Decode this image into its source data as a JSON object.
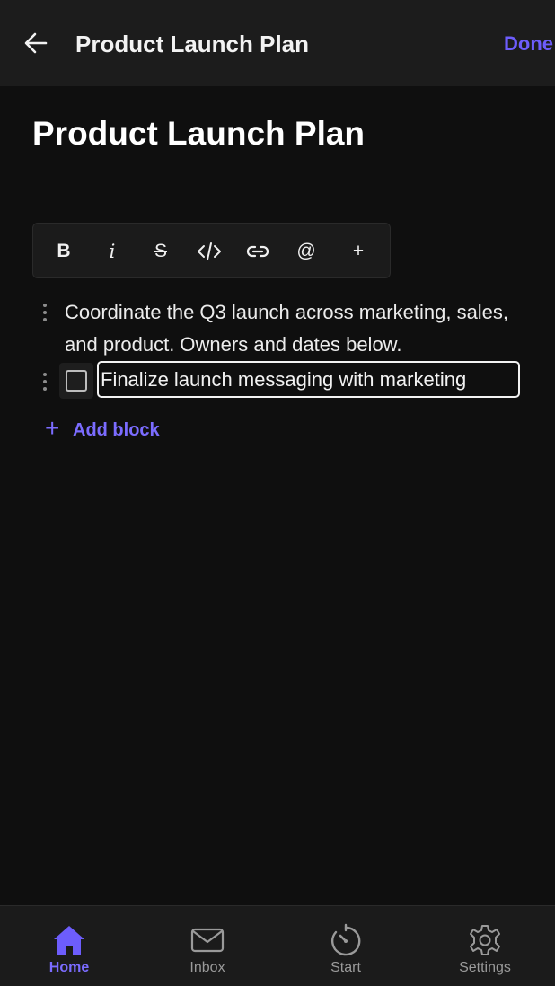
{
  "header": {
    "back_icon": "arrow-left-icon",
    "title": "Product Launch Plan",
    "done_label": "Done"
  },
  "document": {
    "title": "Product Launch Plan",
    "blocks": [
      {
        "type": "paragraph",
        "text": "Coordinate the Q3 launch across marketing, sales, and product. Owners and dates below."
      },
      {
        "type": "todo",
        "checked": false,
        "value": "Finalize launch messaging with marketing"
      }
    ],
    "add_block_label": "Add block"
  },
  "toolbar": {
    "bold": "B",
    "italic": "i",
    "strikethrough": "S",
    "mention": "@",
    "insert": "+"
  },
  "bottom_nav": {
    "items": [
      {
        "label": "Home",
        "icon": "home-icon",
        "active": true
      },
      {
        "label": "Inbox",
        "icon": "mail-icon",
        "active": false
      },
      {
        "label": "Start",
        "icon": "timer-icon",
        "active": false
      },
      {
        "label": "Settings",
        "icon": "gear-icon",
        "active": false
      }
    ]
  },
  "colors": {
    "accent": "#6d5dfc",
    "background": "#0f0f0f",
    "surface": "#1c1c1c"
  }
}
